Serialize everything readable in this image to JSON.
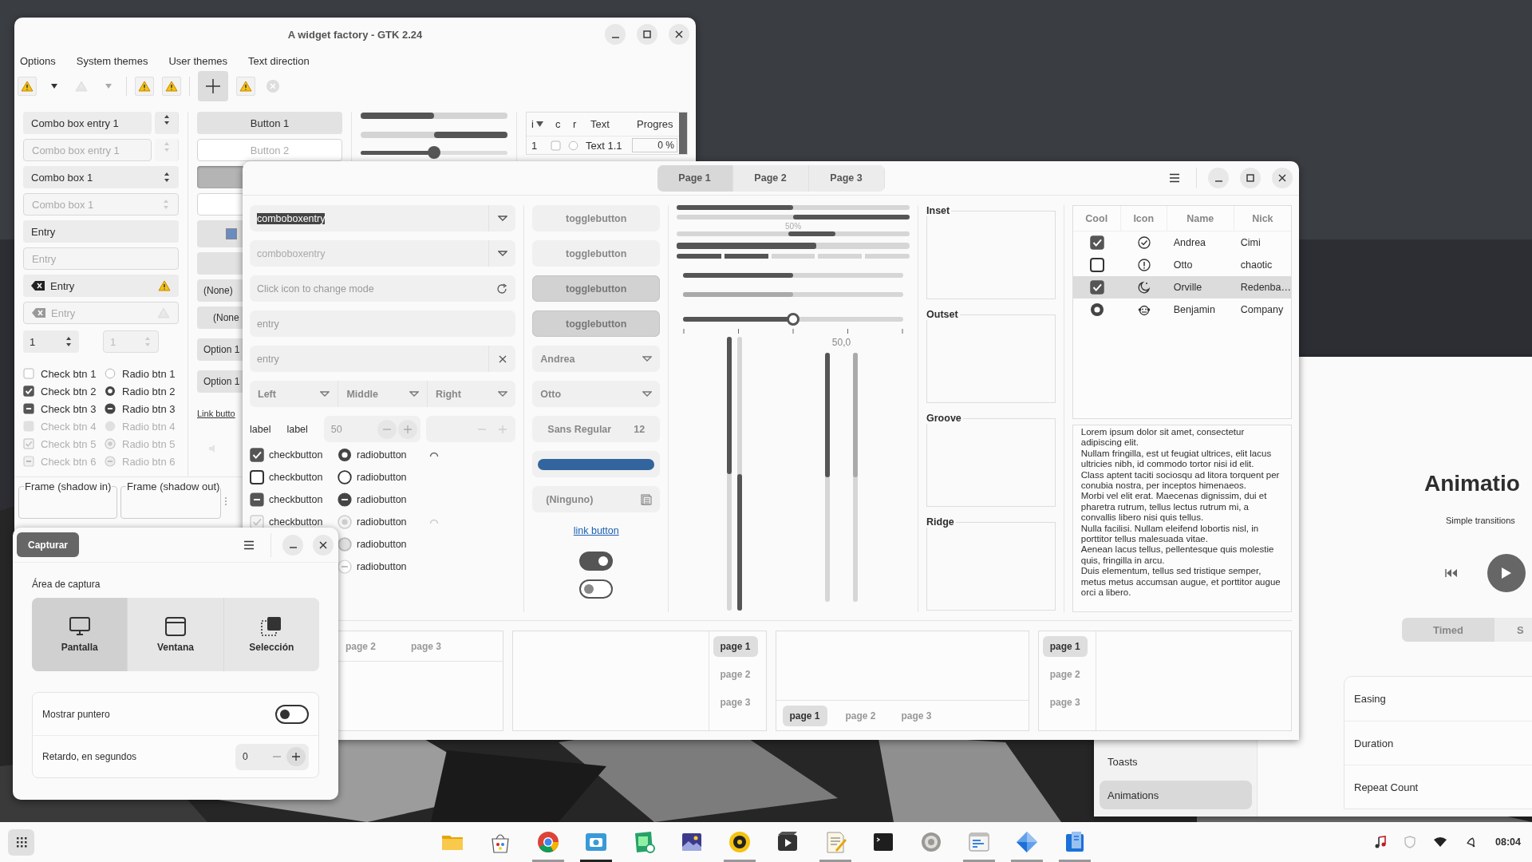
{
  "gtk2_window": {
    "title": "A widget factory - GTK 2.24",
    "menu": [
      "Options",
      "System themes",
      "User themes",
      "Text direction"
    ],
    "toolbar": [
      {
        "kind": "warning",
        "disabled": false,
        "pressed": false
      },
      {
        "kind": "arrow",
        "disabled": false,
        "pressed": false
      },
      {
        "kind": "warning",
        "disabled": true,
        "pressed": false
      },
      {
        "kind": "arrow",
        "disabled": true,
        "pressed": false
      },
      {
        "kind": "separator"
      },
      {
        "kind": "warning",
        "disabled": false,
        "pressed": false
      },
      {
        "kind": "warning",
        "disabled": false,
        "pressed": false
      },
      {
        "kind": "separator"
      },
      {
        "kind": "add",
        "disabled": false,
        "pressed": true
      },
      {
        "kind": "warning",
        "disabled": false,
        "pressed": false
      },
      {
        "kind": "stop",
        "disabled": true,
        "pressed": false
      }
    ],
    "fields": [
      {
        "kind": "combo_entry",
        "value": "Combo box entry 1",
        "disabled": false
      },
      {
        "kind": "combo_entry",
        "value": "Combo box entry 1",
        "disabled": true
      },
      {
        "kind": "combo",
        "value": "Combo box 1",
        "disabled": false
      },
      {
        "kind": "combo",
        "value": "Combo box 1",
        "disabled": true
      },
      {
        "kind": "entry",
        "value": "Entry",
        "disabled": false
      },
      {
        "kind": "entry",
        "value": "Entry",
        "disabled": true
      },
      {
        "kind": "icon_entry",
        "value": "Entry",
        "disabled": false
      },
      {
        "kind": "icon_entry",
        "value": "Entry",
        "disabled": true
      }
    ],
    "spins": [
      {
        "value": "1",
        "disabled": false
      },
      {
        "value": "1",
        "disabled": true
      }
    ],
    "checks": [
      {
        "label": "Check btn 1",
        "checked": false,
        "inconsistent": false,
        "disabled": false
      },
      {
        "label": "Check btn 2",
        "checked": true,
        "inconsistent": false,
        "disabled": false
      },
      {
        "label": "Check btn 3",
        "inconsistent": true,
        "disabled": false
      },
      {
        "label": "Check btn 4",
        "checked": false,
        "inconsistent": false,
        "disabled": true
      },
      {
        "label": "Check btn 5",
        "checked": true,
        "inconsistent": false,
        "disabled": true
      },
      {
        "label": "Check btn 6",
        "inconsistent": true,
        "disabled": true
      }
    ],
    "radios": [
      {
        "label": "Radio btn 1",
        "checked": false,
        "inconsistent": false,
        "disabled": false
      },
      {
        "label": "Radio btn 2",
        "checked": true,
        "inconsistent": false,
        "disabled": false
      },
      {
        "label": "Radio btn 3",
        "inconsistent": true,
        "disabled": false
      },
      {
        "label": "Radio btn 4",
        "checked": false,
        "inconsistent": false,
        "disabled": true
      },
      {
        "label": "Radio btn 5",
        "checked": true,
        "inconsistent": false,
        "disabled": true
      },
      {
        "label": "Radio btn 6",
        "inconsistent": true,
        "disabled": true
      }
    ],
    "buttons": [
      {
        "kind": "button",
        "label": "Button 1",
        "disabled": false,
        "pressed": false
      },
      {
        "kind": "button",
        "label": "Button 2",
        "disabled": true,
        "pressed": false
      },
      {
        "kind": "button",
        "disabled": false,
        "pressed": true
      },
      {
        "kind": "button",
        "disabled": true,
        "pressed": false
      },
      {
        "kind": "color",
        "color": "#6a8cc0"
      },
      {
        "kind": "button",
        "disabled": false,
        "pressed": false
      },
      {
        "kind": "combo",
        "label": "(None)"
      },
      {
        "kind": "combo",
        "label": "(None"
      },
      {
        "kind": "button",
        "label": "Option 1",
        "disabled": false,
        "pressed": false
      },
      {
        "kind": "button",
        "label": "Option 1",
        "disabled": false,
        "pressed": false
      },
      {
        "kind": "link",
        "label": "Link butto"
      },
      {
        "kind": "volume"
      }
    ],
    "bars": [
      {
        "kind": "progress",
        "level": 0.5,
        "inverted": false
      },
      {
        "kind": "progress",
        "level": 0.5,
        "inverted": true
      },
      {
        "kind": "slider",
        "level": 0.5
      }
    ],
    "tree": {
      "columns": [
        {
          "label": "i",
          "sorted": true
        },
        {
          "label": "c",
          "sorted": false
        },
        {
          "label": "r",
          "sorted": false
        },
        {
          "label": "Text",
          "sorted": false
        },
        {
          "label": "Progres",
          "sorted": false
        }
      ],
      "rows": [
        {
          "index": "1",
          "checked": false,
          "active": false,
          "text": "Text 1.1",
          "progress": "0 %"
        }
      ]
    },
    "frames": [
      "Frame (shadow in)",
      "Frame (shadow out)"
    ]
  },
  "main_window": {
    "tabs": [
      {
        "label": "Page 1",
        "selected": true
      },
      {
        "label": "Page 2",
        "selected": false
      },
      {
        "label": "Page 3",
        "selected": false
      }
    ],
    "fields": [
      {
        "kind": "combo_entry",
        "value": "comboboxentry",
        "disabled": false,
        "text_selected": true
      },
      {
        "kind": "combo_entry",
        "value": "comboboxentry",
        "disabled": true,
        "text_selected": false
      },
      {
        "kind": "mode_entry",
        "placeholder": "Click icon to change mode"
      },
      {
        "kind": "entry",
        "placeholder": "entry"
      },
      {
        "kind": "clear_entry",
        "placeholder": "entry"
      }
    ],
    "combo_row": [
      "Left",
      "Middle",
      "Right"
    ],
    "labels": [
      "label",
      "label"
    ],
    "spins": [
      {
        "value": "50",
        "disabled": false
      },
      {
        "disabled": true
      }
    ],
    "checks": [
      {
        "label": "checkbutton",
        "checked": true,
        "inconsistent": false,
        "disabled": false
      },
      {
        "label": "checkbutton",
        "checked": false,
        "inconsistent": false,
        "disabled": false
      },
      {
        "label": "checkbutton",
        "inconsistent": true,
        "disabled": false
      },
      {
        "label": "checkbutton",
        "checked": true,
        "inconsistent": false,
        "disabled": true
      }
    ],
    "radios": [
      {
        "label": "radiobutton",
        "checked": true,
        "inconsistent": false,
        "disabled": false
      },
      {
        "label": "radiobutton",
        "checked": false,
        "inconsistent": false,
        "disabled": false
      },
      {
        "label": "radiobutton",
        "inconsistent": true,
        "disabled": false
      },
      {
        "label": "radiobutton",
        "checked": true,
        "inconsistent": false,
        "disabled": true
      },
      {
        "label": "radiobutton",
        "checked": false,
        "inconsistent": false,
        "disabled": true
      },
      {
        "label": "radiobutton",
        "inconsistent": true,
        "disabled": true
      }
    ],
    "spinners": [
      {
        "disabled": false
      },
      {
        "disabled": true
      }
    ],
    "buttons": [
      {
        "kind": "toggle",
        "label": "togglebutton",
        "pressed": false
      },
      {
        "kind": "toggle",
        "label": "togglebutton",
        "pressed": false
      },
      {
        "kind": "toggle",
        "label": "togglebutton",
        "pressed": true
      },
      {
        "kind": "toggle",
        "label": "togglebutton",
        "pressed": true
      },
      {
        "kind": "combo",
        "label": "Andrea"
      },
      {
        "kind": "combo",
        "label": "Otto"
      },
      {
        "kind": "font",
        "label": "Sans Regular",
        "size": "12"
      },
      {
        "kind": "color",
        "color": "#32659e"
      },
      {
        "kind": "file",
        "label": "(Ninguno)"
      },
      {
        "kind": "link",
        "label": "link button"
      },
      {
        "kind": "switch",
        "on": true
      },
      {
        "kind": "switch",
        "on": false
      }
    ],
    "bars": [
      {
        "kind": "progress",
        "level": 0.5,
        "inverted": false
      },
      {
        "kind": "progress",
        "level": 0.5,
        "inverted": true
      },
      {
        "kind": "pulse",
        "text": "50%"
      },
      {
        "kind": "thick",
        "level": 0.6
      },
      {
        "kind": "segments",
        "level": 0.4
      },
      {
        "kind": "scale",
        "level": 0.5,
        "disabled": false
      },
      {
        "kind": "scale",
        "level": 0.5,
        "disabled": true
      },
      {
        "kind": "slider",
        "level": 0.5
      }
    ],
    "vertical_bars": [
      {
        "level": 0.5,
        "inverted": false
      },
      {
        "level": 0.5,
        "inverted": true
      }
    ],
    "scale_value": "50,0",
    "vertical_scales": [
      {
        "level": 0.5,
        "disabled": false
      },
      {
        "level": 0.5,
        "disabled": true
      }
    ],
    "frames": [
      "Inset",
      "Outset",
      "Groove",
      "Ridge"
    ],
    "tree": {
      "columns": [
        "Cool",
        "Icon",
        "Name",
        "Nick"
      ],
      "rows": [
        {
          "kind": "check",
          "checked": true,
          "name": "Andrea",
          "nick": "Cimi",
          "selected": false
        },
        {
          "kind": "check",
          "checked": false,
          "name": "Otto",
          "nick": "chaotic",
          "selected": false
        },
        {
          "kind": "check",
          "checked": true,
          "name": "Orville",
          "nick": "Redenba…",
          "selected": true
        },
        {
          "kind": "radio",
          "checked": true,
          "name": "Benjamin",
          "nick": "Company",
          "selected": false
        }
      ]
    },
    "text_view": [
      "Lorem ipsum dolor sit amet, consectetur adipiscing elit.",
      "Nullam fringilla, est ut feugiat ultrices, elit lacus ultricies nibh, id commodo tortor nisi id elit.",
      "Class aptent taciti sociosqu ad litora torquent per conubia nostra, per inceptos himenaeos.",
      "Morbi vel elit erat. Maecenas dignissim, dui et pharetra rutrum, tellus lectus rutrum mi, a convallis libero nisi quis tellus.",
      "Nulla facilisi. Nullam eleifend lobortis nisl, in porttitor tellus malesuada vitae.",
      "Aenean lacus tellus, pellentesque quis molestie quis, fringilla in arcu.",
      "Duis elementum, tellus sed tristique semper, metus metus accumsan augue, et porttitor augue orci a libero."
    ],
    "notebooks": [
      {
        "kind": "top",
        "tabs": [
          {
            "label": "page 2",
            "selected": false
          },
          {
            "label": "page 3",
            "selected": false
          }
        ]
      },
      {
        "kind": "right",
        "tabs": [
          {
            "label": "page 1",
            "selected": true
          },
          {
            "label": "page 2",
            "selected": false
          },
          {
            "label": "page 3",
            "selected": false
          }
        ]
      },
      {
        "kind": "bottom",
        "tabs": [
          {
            "label": "page 1",
            "selected": true
          },
          {
            "label": "page 2",
            "selected": false
          },
          {
            "label": "page 3",
            "selected": false
          }
        ]
      },
      {
        "kind": "left",
        "tabs": [
          {
            "label": "page 1",
            "selected": true
          },
          {
            "label": "page 2",
            "selected": false
          },
          {
            "label": "page 3",
            "selected": false
          }
        ]
      }
    ]
  },
  "capture_dialog": {
    "title_button": "Capturar",
    "area_label": "Área de captura",
    "modes": [
      {
        "label": "Pantalla",
        "selected": true
      },
      {
        "label": "Ventana",
        "selected": false
      },
      {
        "label": "Selección",
        "selected": false
      }
    ],
    "rows": [
      {
        "kind": "switch",
        "label": "Mostrar puntero",
        "on": false
      },
      {
        "kind": "spin",
        "label": "Retardo, en segundos",
        "value": "0"
      }
    ]
  },
  "adw_window": {
    "sidebar": [
      {
        "label": "Toasts",
        "selected": false
      },
      {
        "label": "Animations",
        "selected": true
      }
    ],
    "title": "Animatio",
    "subtitle": "Simple transitions",
    "modes": [
      {
        "label": "Timed",
        "selected": true
      },
      {
        "label": "S",
        "selected": false
      }
    ],
    "rows": [
      "Easing",
      "Duration",
      "Repeat Count"
    ]
  },
  "taskbar": {
    "apps": [
      {
        "running": false,
        "focused": false
      },
      {
        "running": false,
        "focused": false
      },
      {
        "running": true,
        "focused": false
      },
      {
        "running": true,
        "focused": true
      },
      {
        "running": false,
        "focused": false
      },
      {
        "running": false,
        "focused": false
      },
      {
        "running": true,
        "focused": false
      },
      {
        "running": false,
        "focused": false
      },
      {
        "running": true,
        "focused": false
      },
      {
        "running": false,
        "focused": false
      },
      {
        "running": false,
        "focused": false
      },
      {
        "running": true,
        "focused": false
      },
      {
        "running": true,
        "focused": false
      },
      {
        "running": true,
        "focused": false
      }
    ],
    "clock": "08:04"
  }
}
